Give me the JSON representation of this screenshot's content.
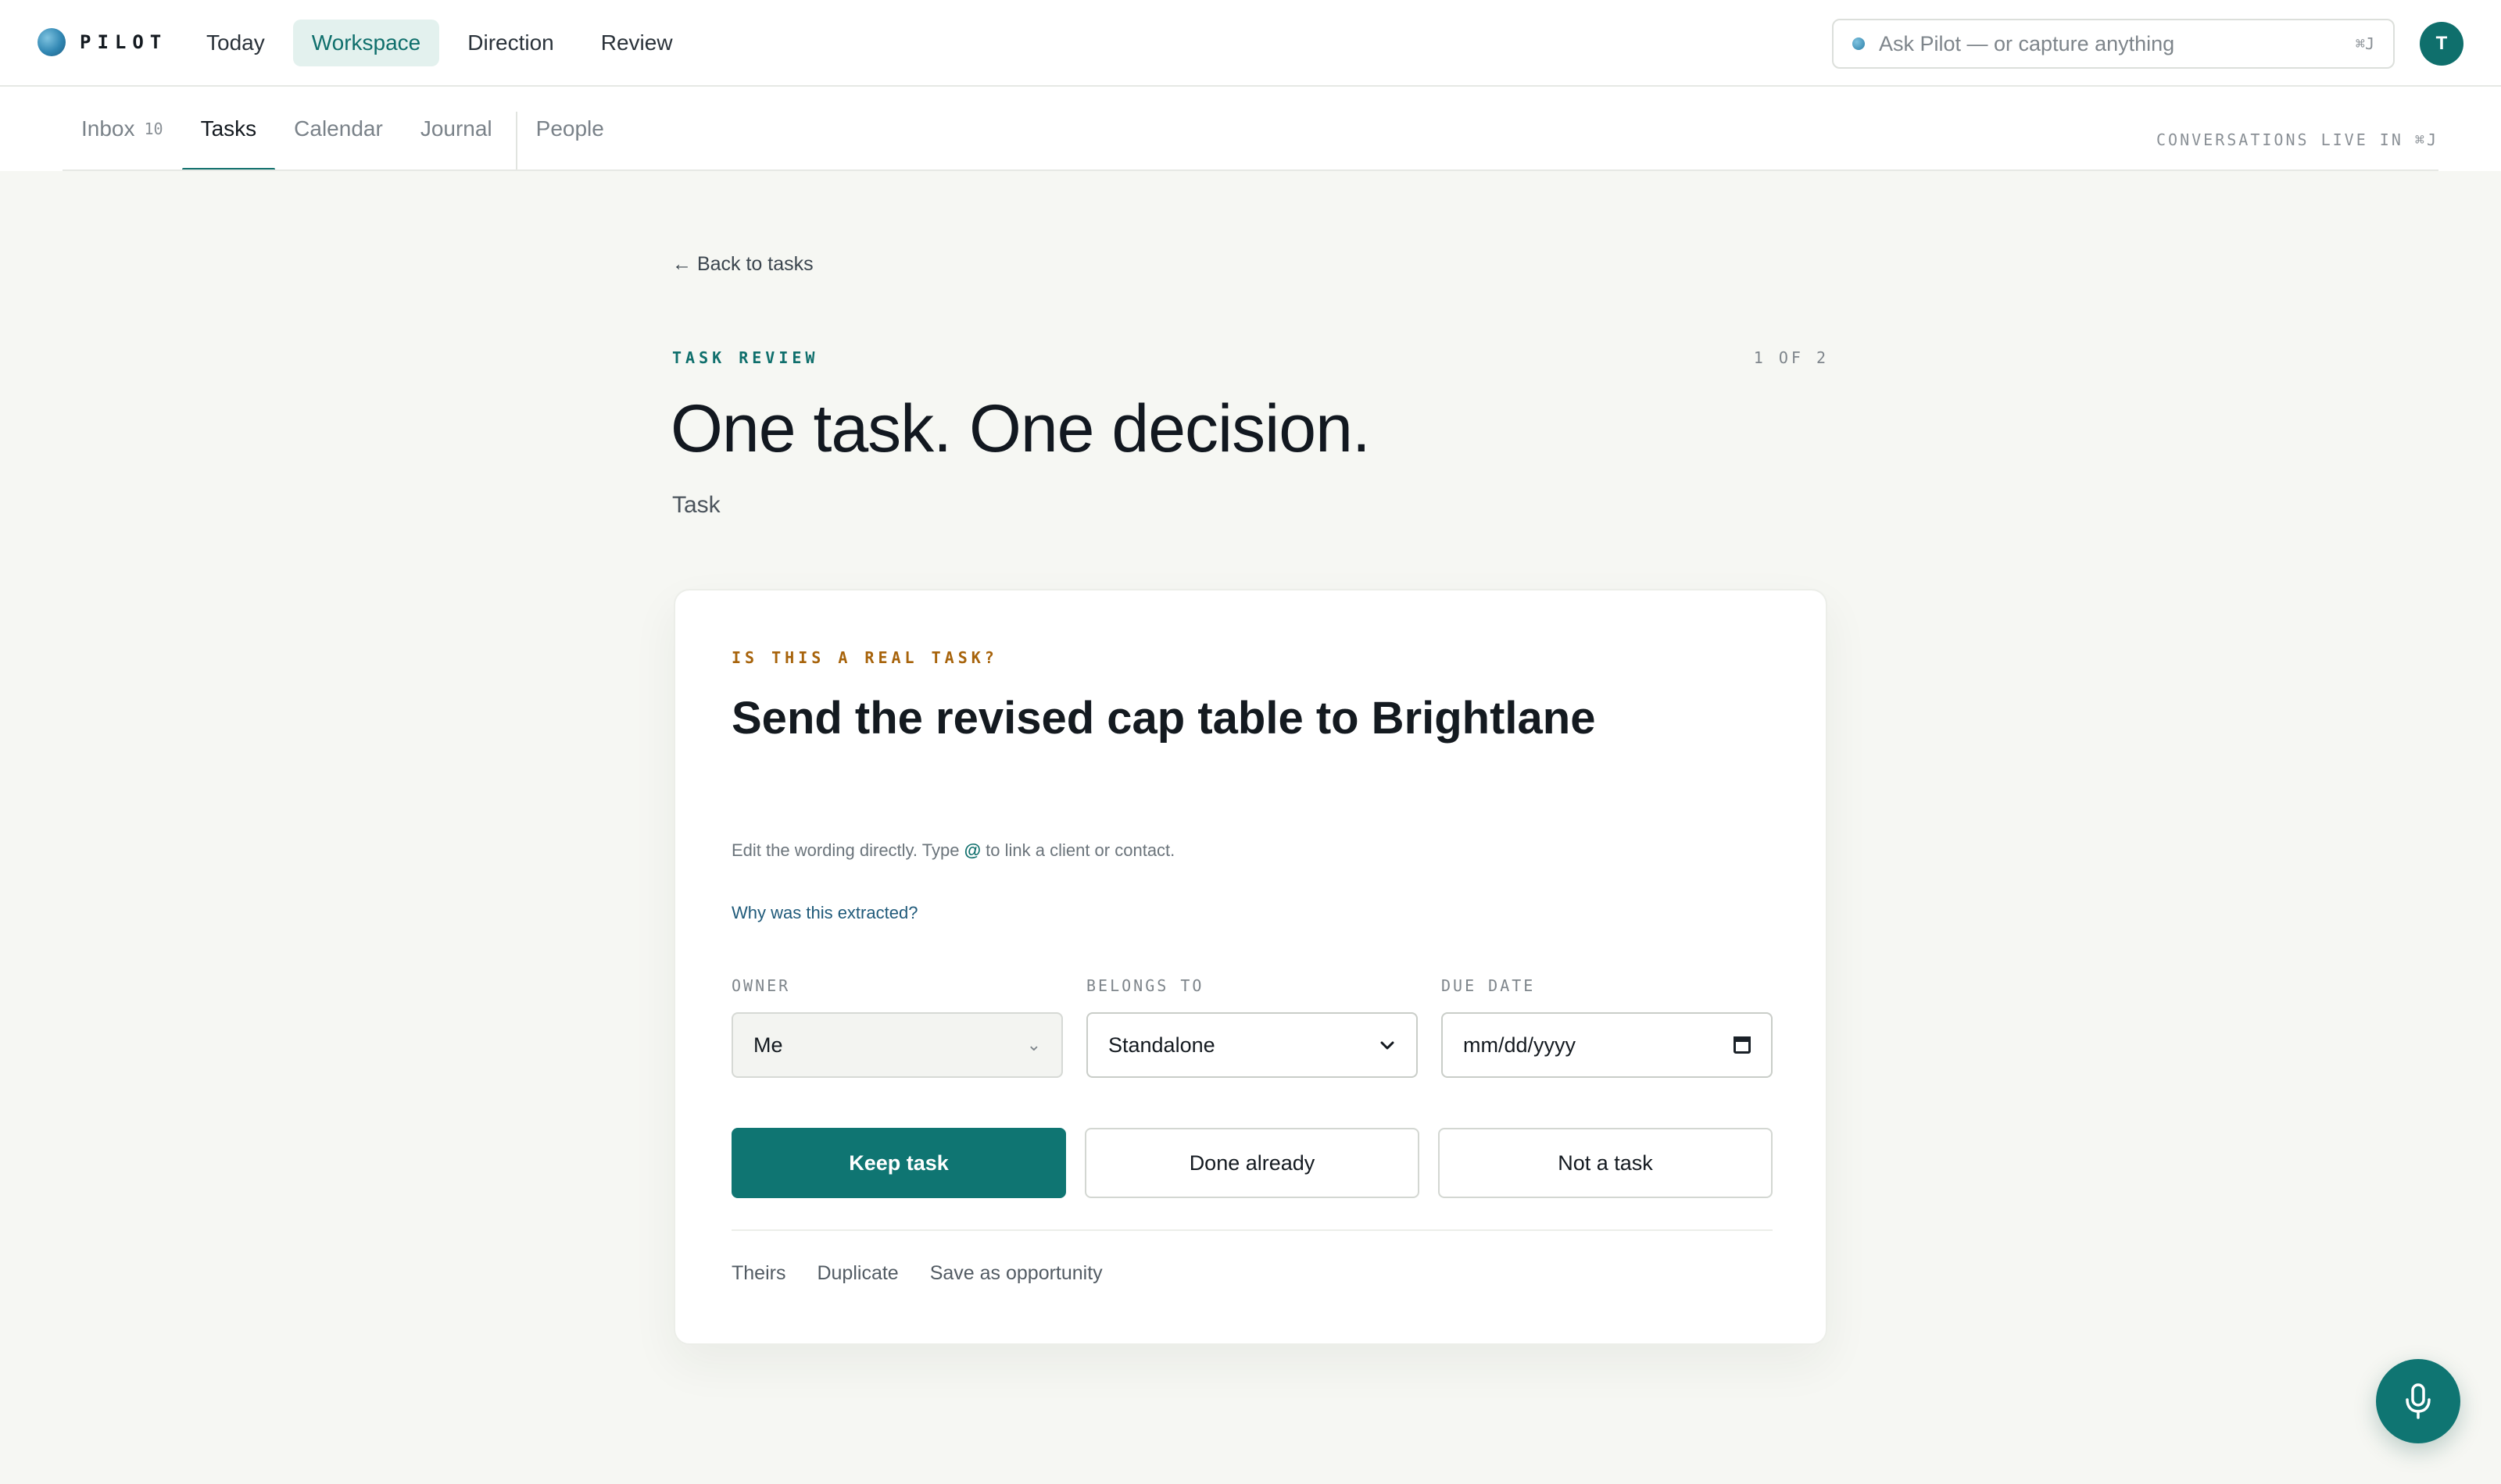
{
  "brand": {
    "name": "PILOT"
  },
  "mainnav": [
    {
      "label": "Today",
      "active": false
    },
    {
      "label": "Workspace",
      "active": true
    },
    {
      "label": "Direction",
      "active": false
    },
    {
      "label": "Review",
      "active": false
    }
  ],
  "search": {
    "placeholder": "Ask Pilot — or capture anything",
    "shortcut": "⌘J"
  },
  "avatar": {
    "initial": "T"
  },
  "subnav": {
    "tabs": [
      {
        "label": "Inbox",
        "count": "10"
      },
      {
        "label": "Tasks",
        "count": ""
      },
      {
        "label": "Calendar",
        "count": ""
      },
      {
        "label": "Journal",
        "count": ""
      }
    ],
    "extra_tab": "People",
    "note": "CONVERSATIONS LIVE IN ⌘J"
  },
  "page": {
    "back": "Back to tasks",
    "eyebrow": "TASK REVIEW",
    "counter": "1 OF 2",
    "headline": "One task. One decision.",
    "subtitle": "Task"
  },
  "card": {
    "eyebrow": "IS THIS A REAL TASK?",
    "task_title": "Send the revised cap table to Brightlane",
    "hint_before": "Edit the wording directly. Type",
    "hint_at": "@",
    "hint_after": "to link a client or contact.",
    "why_link": "Why was this extracted?",
    "fields": {
      "owner_label": "OWNER",
      "owner_value": "Me",
      "belongs_label": "BELONGS TO",
      "belongs_value": "Standalone",
      "due_label": "DUE DATE",
      "due_value": "mm/dd/yyyy"
    },
    "actions": {
      "keep": "Keep task",
      "done": "Done already",
      "not_task": "Not a task"
    },
    "footer": [
      "Theirs",
      "Duplicate",
      "Save as opportunity"
    ]
  },
  "colors": {
    "accent": "#0f7572",
    "warning_label": "#a7630b",
    "link": "#1f5a7a"
  }
}
